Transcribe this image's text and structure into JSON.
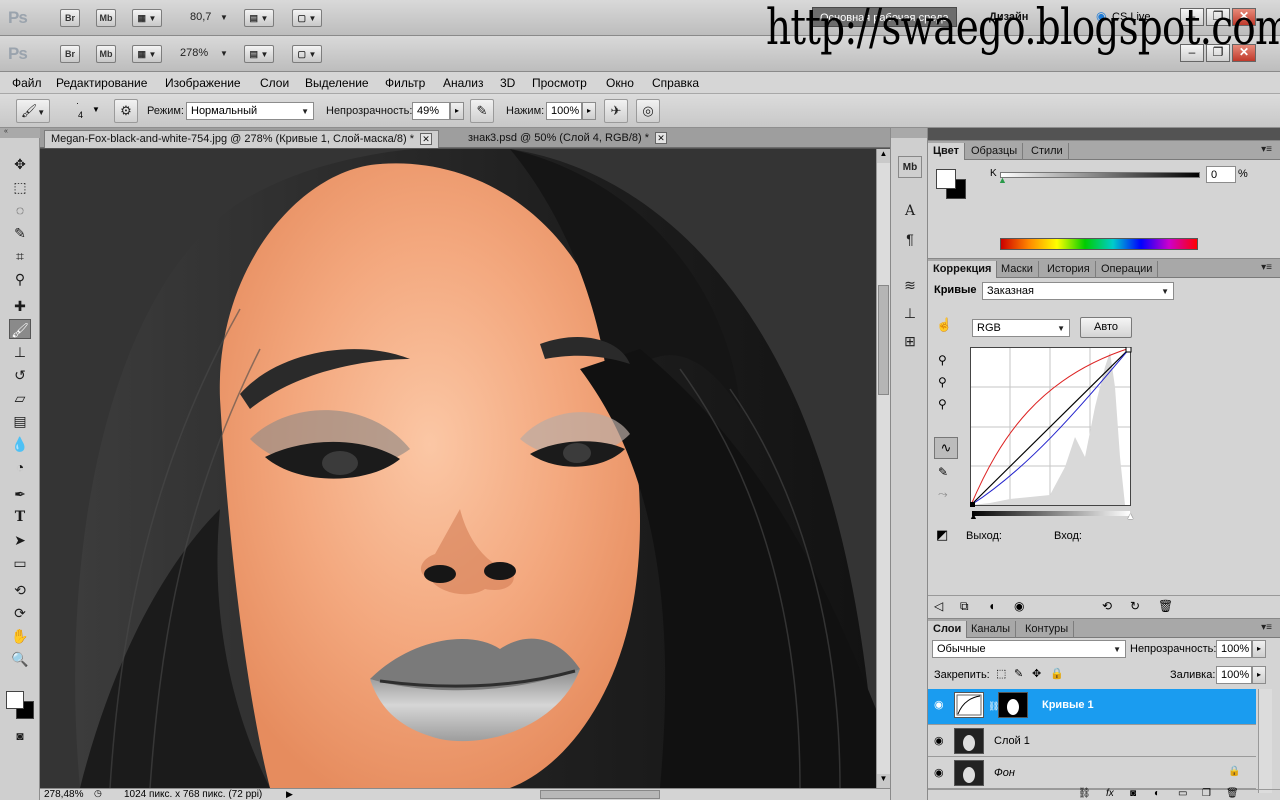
{
  "watermark": "http://swaego.blogspot.com",
  "appbar_back": {
    "logo": "Ps",
    "bridge": "Br",
    "minibridge": "Mb",
    "zoom": "80,7",
    "workspace": "Основная рабочая среда",
    "design": "Дизайн",
    "cslive": "CS Live"
  },
  "appbar_front": {
    "logo": "Ps",
    "bridge": "Br",
    "minibridge": "Mb",
    "zoom": "278%"
  },
  "menu": [
    "Файл",
    "Редактирование",
    "Изображение",
    "Слои",
    "Выделение",
    "Фильтр",
    "Анализ",
    "3D",
    "Просмотр",
    "Окно",
    "Справка"
  ],
  "options": {
    "brush_size": "4",
    "mode_label": "Режим:",
    "mode_value": "Нормальный",
    "opacity_label": "Непрозрачность:",
    "opacity_value": "49%",
    "flow_label": "Нажим:",
    "flow_value": "100%"
  },
  "tabs": [
    {
      "label": "Megan-Fox-black-and-white-754.jpg @ 278% (Кривые 1, Слой-маска/8) *",
      "active": true
    },
    {
      "label": "знак3.psd @ 50% (Слой 4, RGB/8) *",
      "active": false
    }
  ],
  "status": {
    "zoom": "278,48%",
    "doc_info": "1024 пикс. x 768 пикс. (72 ppi)"
  },
  "color_panel": {
    "tabs": [
      "Цвет",
      "Образцы",
      "Стили"
    ],
    "channel": "K",
    "value": "0",
    "unit": "%"
  },
  "adjust_panel": {
    "tabs": [
      "Коррекция",
      "Маски",
      "История",
      "Операции"
    ],
    "curves_label": "Кривые",
    "preset": "Заказная",
    "channel": "RGB",
    "auto_btn": "Авто",
    "output_label": "Выход:",
    "input_label": "Вход:"
  },
  "layers_panel": {
    "tabs": [
      "Слои",
      "Каналы",
      "Контуры"
    ],
    "blend_mode": "Обычные",
    "opacity_label": "Непрозрачность:",
    "opacity_value": "100%",
    "lock_label": "Закрепить:",
    "fill_label": "Заливка:",
    "fill_value": "100%",
    "layers": [
      {
        "name": "Кривые 1",
        "selected": true
      },
      {
        "name": "Слой 1",
        "selected": false
      },
      {
        "name": "Фон",
        "selected": false
      }
    ]
  }
}
